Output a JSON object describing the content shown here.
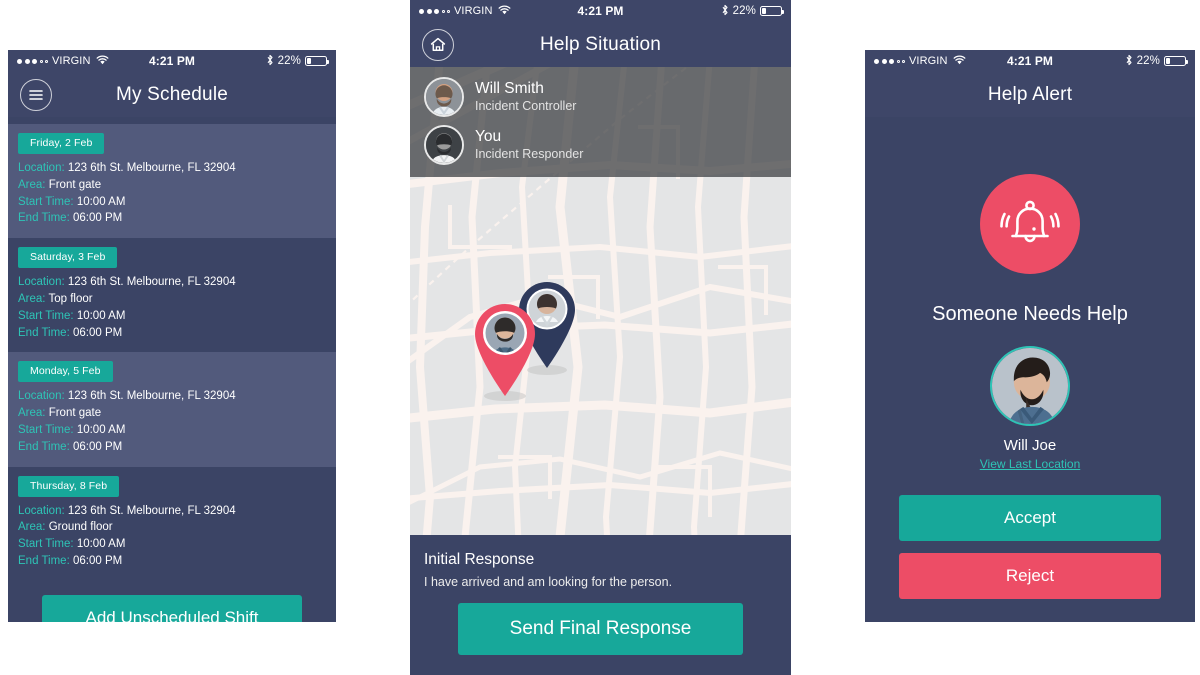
{
  "colors": {
    "navy": "#3b4465",
    "navy_bar": "#3e4668",
    "row_alt": "#525a7c",
    "teal": "#17a89a",
    "teal_accent": "#2ec4b6",
    "red": "#ed4d66",
    "map_bg": "#e4e5e6",
    "map_street": "#faf2ee"
  },
  "status_bar": {
    "carrier": "VIRGIN",
    "time": "4:21 PM",
    "battery_percent": "22%",
    "battery_level": 22,
    "signal_filled": 3,
    "signal_empty": 2,
    "wifi_icon": "wifi-icon",
    "bluetooth_icon": "bluetooth-icon",
    "battery_icon": "battery-icon"
  },
  "schedule_screen": {
    "nav": {
      "title": "My Schedule",
      "menu_icon": "hamburger-menu-icon"
    },
    "shifts": [
      {
        "day": "Friday, 2 Feb",
        "location_label": "Location:",
        "location": "123 6th St. Melbourne, FL 32904",
        "area_label": "Area:",
        "area": "Front gate",
        "start_label": "Start Time:",
        "start": "10:00 AM",
        "end_label": "End Time:",
        "end": "06:00 PM"
      },
      {
        "day": "Saturday, 3 Feb",
        "location_label": "Location:",
        "location": "123 6th St. Melbourne, FL 32904",
        "area_label": "Area:",
        "area": "Top floor",
        "start_label": "Start Time:",
        "start": "10:00 AM",
        "end_label": "End Time:",
        "end": "06:00 PM"
      },
      {
        "day": "Monday, 5 Feb",
        "location_label": "Location:",
        "location": "123 6th St. Melbourne, FL 32904",
        "area_label": "Area:",
        "area": "Front gate",
        "start_label": "Start Time:",
        "start": "10:00 AM",
        "end_label": "End Time:",
        "end": "06:00 PM"
      },
      {
        "day": "Thursday, 8 Feb",
        "location_label": "Location:",
        "location": "123 6th St. Melbourne, FL 32904",
        "area_label": "Area:",
        "area": "Ground floor",
        "start_label": "Start Time:",
        "start": "10:00 AM",
        "end_label": "End Time:",
        "end": "06:00 PM"
      }
    ],
    "add_shift_label": "Add Unscheduled Shift"
  },
  "help_screen": {
    "nav": {
      "title": "Help Situation",
      "home_icon": "home-icon"
    },
    "people": [
      {
        "name": "Will Smith",
        "role": "Incident Controller",
        "avatar": "avatar-will-smith"
      },
      {
        "name": "You",
        "role": "Incident Responder",
        "avatar": "avatar-you"
      }
    ],
    "map": {
      "pin_front": "map-pin-responder",
      "pin_back": "map-pin-controller"
    },
    "response": {
      "title": "Initial Response",
      "message": "I have arrived and am looking for the person.",
      "send_label": "Send Final Response"
    }
  },
  "alert_screen": {
    "nav": {
      "title": "Help Alert"
    },
    "bell_icon": "alert-bell-icon",
    "headline": "Someone Needs Help",
    "person_name": "Will Joe",
    "person_avatar": "avatar-will-joe",
    "view_location_label": "View Last Location",
    "accept_label": "Accept",
    "reject_label": "Reject"
  }
}
